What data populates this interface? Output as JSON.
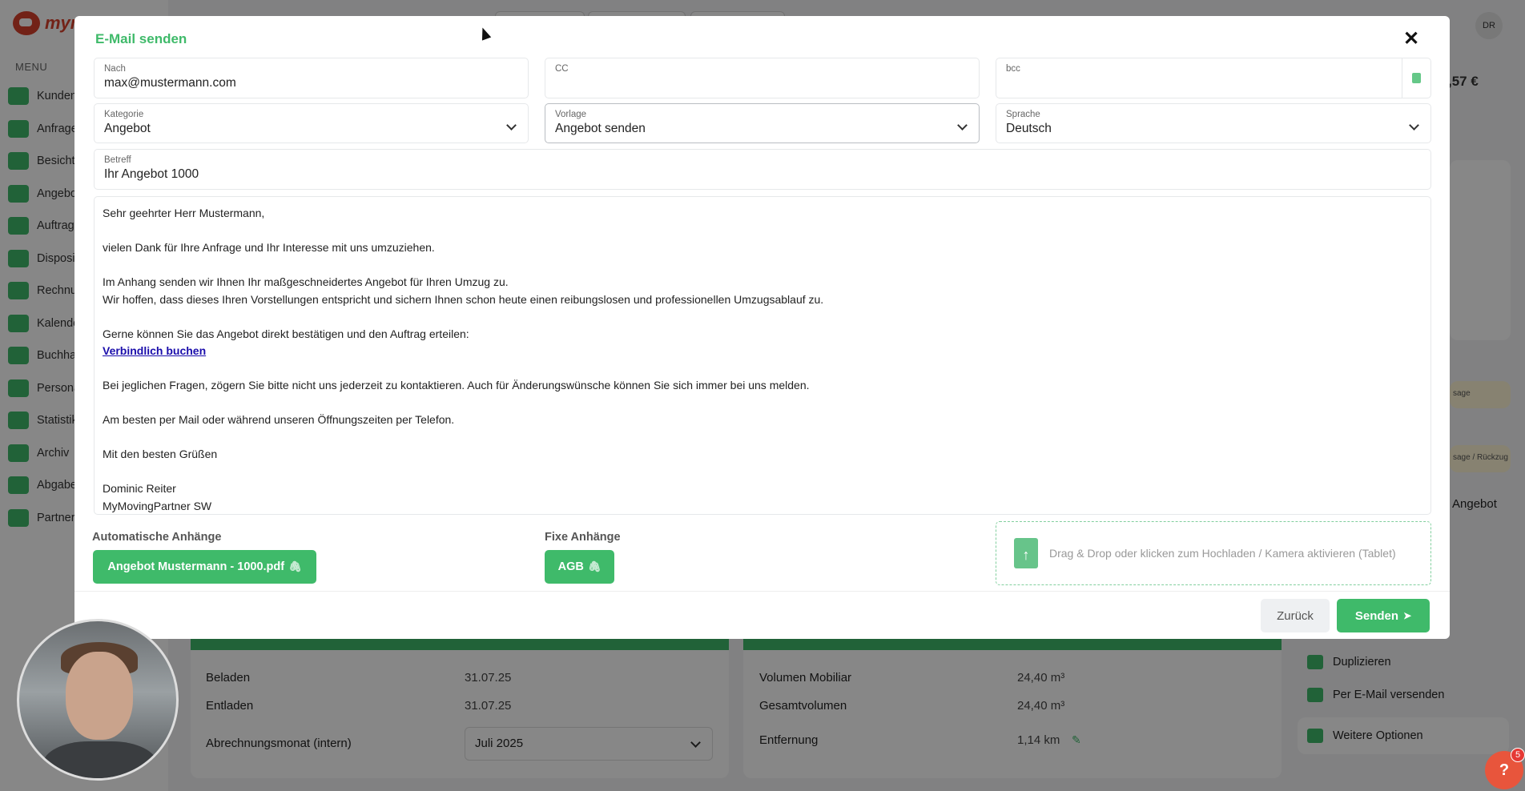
{
  "app": {
    "logo_text": "mym",
    "menu_label": "MENU",
    "menu_items": [
      {
        "label": "Kunden",
        "icon": "customers-icon"
      },
      {
        "label": "Anfrage",
        "icon": "inquiry-icon"
      },
      {
        "label": "Besichti",
        "icon": "inspection-icon"
      },
      {
        "label": "Angebo",
        "icon": "offer-icon"
      },
      {
        "label": "Auftrags",
        "icon": "order-icon"
      },
      {
        "label": "Disposit",
        "icon": "dispatch-icon"
      },
      {
        "label": "Rechnu",
        "icon": "invoice-icon"
      },
      {
        "label": "Kalende",
        "icon": "calendar-icon"
      },
      {
        "label": "Buchhal",
        "icon": "accounting-icon"
      },
      {
        "label": "Persona",
        "icon": "staff-icon"
      },
      {
        "label": "Statistik",
        "icon": "statistics-icon"
      },
      {
        "label": "Archiv",
        "icon": "archive-icon"
      },
      {
        "label": "Abgabe",
        "icon": "delivery-icon"
      },
      {
        "label": "Partner",
        "icon": "partner-icon"
      }
    ],
    "user_initials": "DR",
    "amount": ",57 €",
    "note_a": "sage",
    "note_b": "sage / Rückzug",
    "offer_label": "Angebot",
    "details_left": [
      {
        "label": "Beladen",
        "value": "31.07.25"
      },
      {
        "label": "Entladen",
        "value": "31.07.25"
      }
    ],
    "billing_month_label": "Abrechnungsmonat (intern)",
    "billing_month_value": "Juli 2025",
    "details_right": [
      {
        "label": "Volumen Mobiliar",
        "value": "24,40 m³"
      },
      {
        "label": "Gesamtvolumen",
        "value": "24,40 m³"
      },
      {
        "label": "Entfernung",
        "value": "1,14 km"
      }
    ],
    "side_actions": {
      "duplicate": "Duplizieren",
      "send_email": "Per E-Mail versenden",
      "more_options": "Weitere Optionen"
    },
    "help": {
      "icon": "?",
      "badge": "5"
    }
  },
  "modal": {
    "title": "E-Mail senden",
    "close_icon": "✕",
    "to": {
      "label": "Nach",
      "value": "max@mustermann.com"
    },
    "cc": {
      "label": "CC",
      "value": ""
    },
    "bcc": {
      "label": "bcc",
      "value": ""
    },
    "category": {
      "label": "Kategorie",
      "value": "Angebot"
    },
    "template": {
      "label": "Vorlage",
      "value": "Angebot senden"
    },
    "language": {
      "label": "Sprache",
      "value": "Deutsch"
    },
    "subject": {
      "label": "Betreff",
      "value": "Ihr Angebot 1000"
    },
    "body": {
      "greeting": "Sehr geehrter Herr Mustermann,",
      "line_thanks": "vielen Dank für Ihre Anfrage und Ihr Interesse mit uns umzuziehen.",
      "line_attach": "Im Anhang senden wir Ihnen Ihr maßgeschneidertes Angebot für Ihren Umzug zu.",
      "line_hope": "Wir hoffen, dass dieses Ihren Vorstellungen entspricht und sichern Ihnen schon heute einen reibungslosen und professionellen Umzugsablauf zu.",
      "line_confirm": "Gerne können Sie das Angebot direkt bestätigen und den Auftrag erteilen:",
      "link_book": "Verbindlich buchen",
      "line_questions": "Bei jeglichen Fragen, zögern Sie bitte nicht uns jederzeit zu kontaktieren. Auch für Änderungswünsche können Sie sich immer bei uns melden.",
      "line_contact": "Am besten per Mail oder während unseren Öffnungszeiten per Telefon.",
      "line_regards": "Mit den besten Grüßen",
      "signature_name": "Dominic Reiter",
      "signature_company": "MyMovingPartner SW"
    },
    "auto_attachments": {
      "title": "Automatische Anhänge",
      "items": [
        "Angebot Mustermann - 1000.pdf"
      ]
    },
    "fixed_attachments": {
      "title": "Fixe Anhänge",
      "items": [
        "AGB"
      ]
    },
    "dropzone_text": "Drag & Drop oder klicken zum Hochladen / Kamera aktivieren (Tablet)",
    "back_label": "Zurück",
    "send_label": "Senden"
  },
  "colors": {
    "accent": "#3fba6a",
    "overlay": "rgba(0,0,0,0.47)",
    "danger": "#e8553c"
  }
}
